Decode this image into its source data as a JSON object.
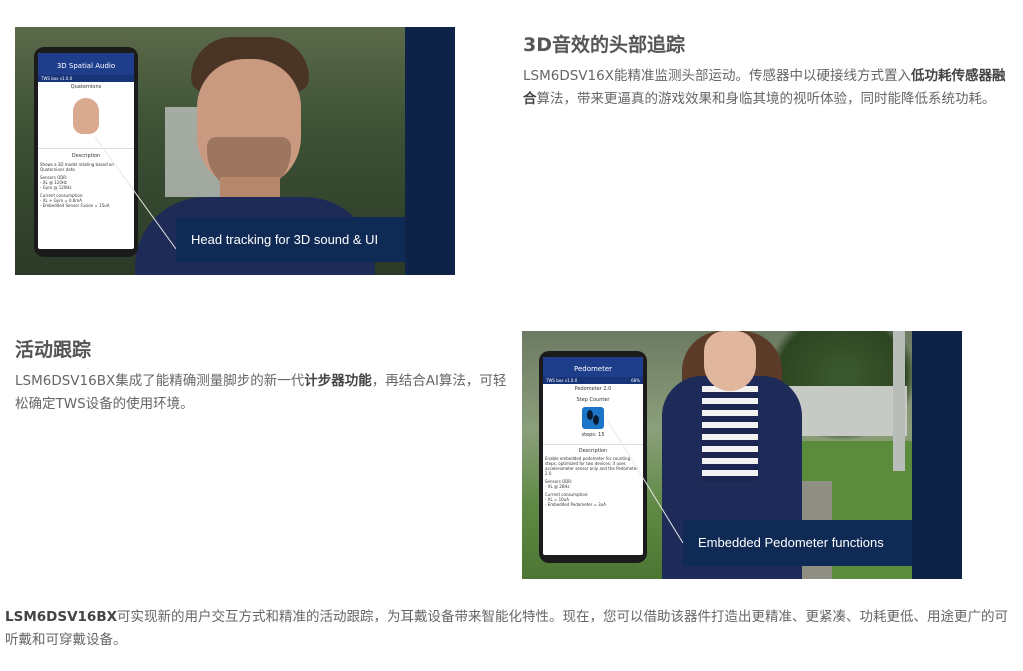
{
  "section1": {
    "image": {
      "phone_app_title": "3D Spatial Audio",
      "phone_status": "TWS box v1.0.0",
      "phone_section": "Quaternions",
      "phone_desc_title": "Description",
      "phone_desc_text": "Shows a 3D model rotating based on Quaternions data",
      "phone_sensors": "Sensors ODR:\n- XL @ 120Hz\n- Gyro @ 120Hz",
      "phone_consumption": "Current consumption:\n- XL + Gyro = 0.6mA\n- Embedded Sensor Fusion = 15uA",
      "caption": "Head tracking for 3D sound & UI"
    },
    "heading": "3D音效的头部追踪",
    "paragraph": {
      "part1": "LSM6DSV16X能精准监测头部运动。传感器中以硬接线方式置入",
      "bold": "低功耗传感器融合",
      "part2": "算法，带来更逼真的游戏效果和身临其境的视听体验，同时能降低系统功耗。"
    }
  },
  "section2": {
    "heading": "活动跟踪",
    "paragraph": {
      "part1": "LSM6DSV16BX集成了能精确测量脚步的新一代",
      "bold": "计步器功能",
      "part2": "，再结合AI算法，可轻松确定TWS设备的使用环境。"
    },
    "image": {
      "phone_app_title": "Pedometer",
      "phone_status": "TWS box v1.0.0",
      "phone_battery": "68%",
      "phone_section": "Pedometer 2.0",
      "phone_subtitle": "Step Counter",
      "phone_steps": "steps: 15",
      "phone_desc_title": "Description",
      "phone_desc_text": "Enable embedded pedometer for counting steps, optimized for two devices; it uses accelerometer sensor only and the Pedometer 2.0",
      "phone_sensors": "Sensors ODR:\n- XL @ 26Hz",
      "phone_consumption": "Current consumption:\n- XL = 10uA\n- Embedded Pedometer = 3uA",
      "caption": "Embedded Pedometer functions"
    }
  },
  "footer": {
    "bold": "LSM6DSV16BX",
    "text": "可实现新的用户交互方式和精准的活动跟踪，为耳戴设备带来智能化特性。现在，您可以借助该器件打造出更精准、更紧凑、功耗更低、用途更广的可听戴和可穿戴设备。"
  }
}
